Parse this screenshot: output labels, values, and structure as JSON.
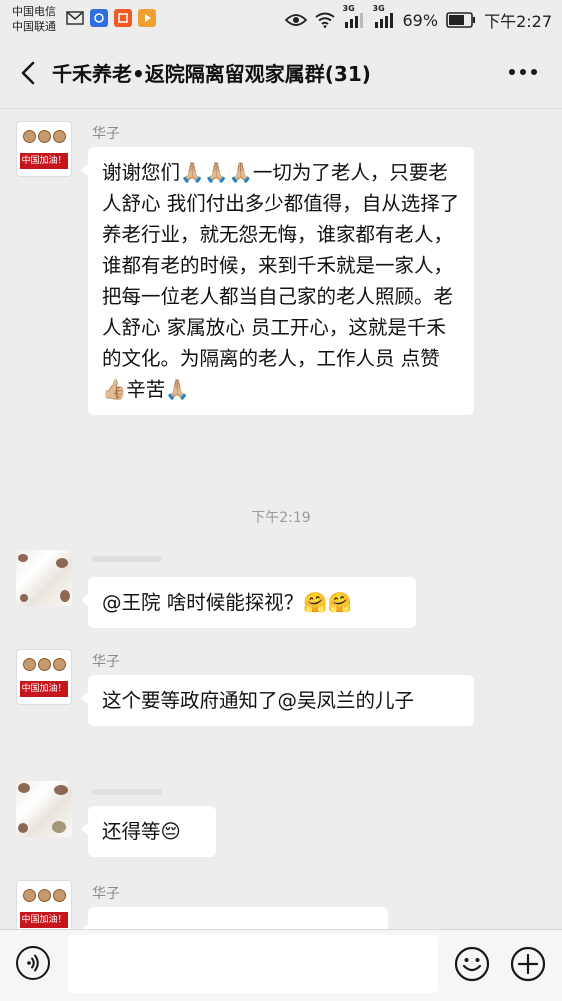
{
  "status_bar": {
    "carrier1": "中国电信",
    "carrier2": "中国联通",
    "net1": "3G",
    "net2": "3G",
    "battery": "69%",
    "time": "下午2:27"
  },
  "header": {
    "title": "千禾养老•返院隔离留观家属群(31)",
    "back_icon": "chevron-left-icon",
    "more_icon": "more-dots-icon"
  },
  "messages": [
    {
      "sender": "华子",
      "avatar_text": "中国加油！",
      "text": "谢谢您们🙏🏼🙏🏼🙏🏼一切为了老人，只要老人舒心 我们付出多少都值得，自从选择了养老行业，就无怨无悔，谁家都有老人，谁都有老的时候，来到千禾就是一家人，把每一位老人都当自己家的老人照顾。老人舒心 家属放心 员工开心，这就是千禾的文化。为隔离的老人，工作人员 点赞👍🏼辛苦🙏🏼"
    },
    {
      "timestamp": "下午2:19"
    },
    {
      "sender": "",
      "text": "@王院 啥时候能探视？🤗🤗"
    },
    {
      "sender": "华子",
      "avatar_text": "中国加油！",
      "text": "这个要等政府通知了@吴凤兰的儿子"
    },
    {
      "sender": "",
      "text": "还得等😔"
    },
    {
      "sender": "华子",
      "avatar_text": "中国加油！"
    }
  ],
  "input_bar": {
    "voice_icon": "voice-icon",
    "emoji_icon": "emoji-icon",
    "plus_icon": "plus-icon"
  }
}
